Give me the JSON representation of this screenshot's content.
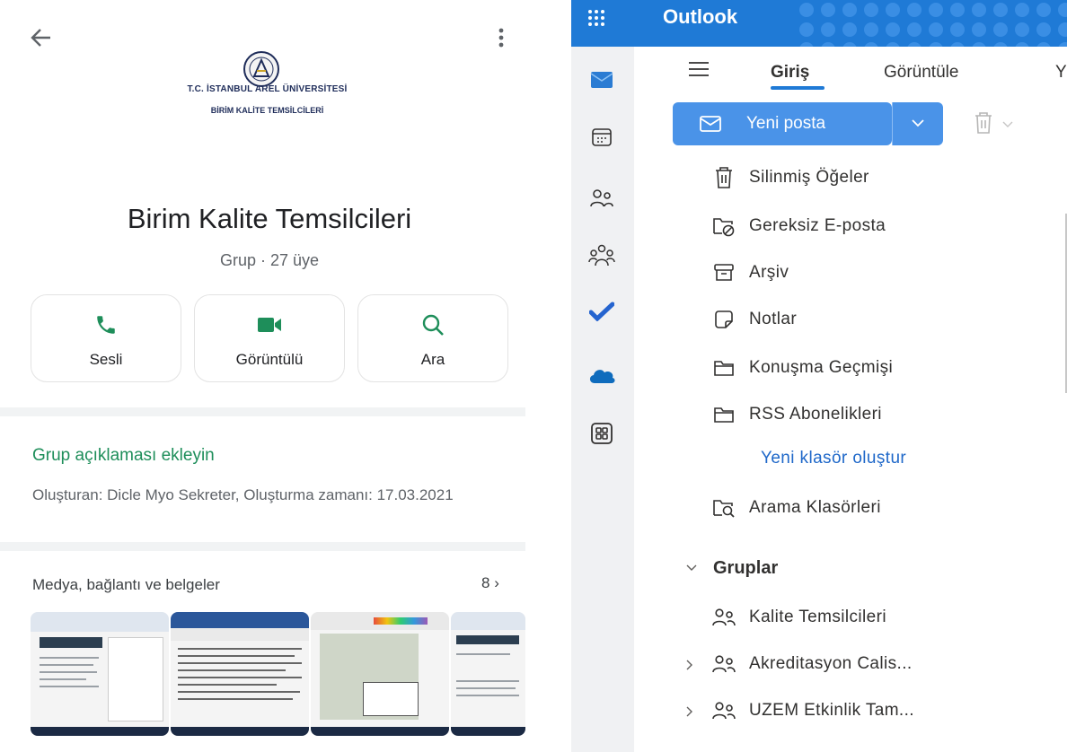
{
  "left": {
    "header": {
      "back_icon": "arrow-left-icon",
      "menu_icon": "more-vert-icon"
    },
    "university": {
      "line1": "T.C. İSTANBUL AREL ÜNİVERSİTESİ",
      "line2": "BİRİM KALİTE TEMSİLCİLERİ"
    },
    "group": {
      "name": "Birim Kalite Temsilcileri",
      "meta": "Grup · 27 üye"
    },
    "actions": [
      {
        "label": "Sesli",
        "icon": "phone-icon"
      },
      {
        "label": "Görüntülü",
        "icon": "video-icon"
      },
      {
        "label": "Ara",
        "icon": "search-icon"
      }
    ],
    "description": {
      "add_link": "Grup açıklaması ekleyin",
      "created": "Oluşturan: Dicle Myo Sekreter, Oluşturma zamanı: 17.03.2021"
    },
    "media": {
      "title": "Medya, bağlantı ve belgeler",
      "count": "8",
      "thumbnail_count": 4
    },
    "colors": {
      "accent": "#1e8e5a"
    }
  },
  "right": {
    "app_title": "Outlook",
    "tabs": [
      "Giriş",
      "Görüntüle",
      "Y"
    ],
    "new_mail": "Yeni posta",
    "folders": [
      {
        "label": "Silinmiş Öğeler",
        "icon": "trash-icon"
      },
      {
        "label": "Gereksiz E-posta",
        "icon": "junk-folder-icon"
      },
      {
        "label": "Arşiv",
        "icon": "archive-icon"
      },
      {
        "label": "Notlar",
        "icon": "note-icon"
      },
      {
        "label": "Konuşma Geçmişi",
        "icon": "folder-icon"
      },
      {
        "label": "RSS Abonelikleri",
        "icon": "folder-icon"
      }
    ],
    "new_folder": "Yeni klasör oluştur",
    "search_folders": "Arama Klasörleri",
    "groups_header": "Gruplar",
    "groups": [
      "Kalite Temsilcileri",
      "Akreditasyon Calis...",
      "UZEM Etkinlik Tam..."
    ],
    "rail": [
      "mail-icon",
      "calendar-icon",
      "people-icon",
      "groups-icon",
      "todo-icon",
      "onedrive-icon",
      "apps-icon"
    ],
    "colors": {
      "brand": "#1f7ad6",
      "link": "#1f68c9"
    }
  }
}
